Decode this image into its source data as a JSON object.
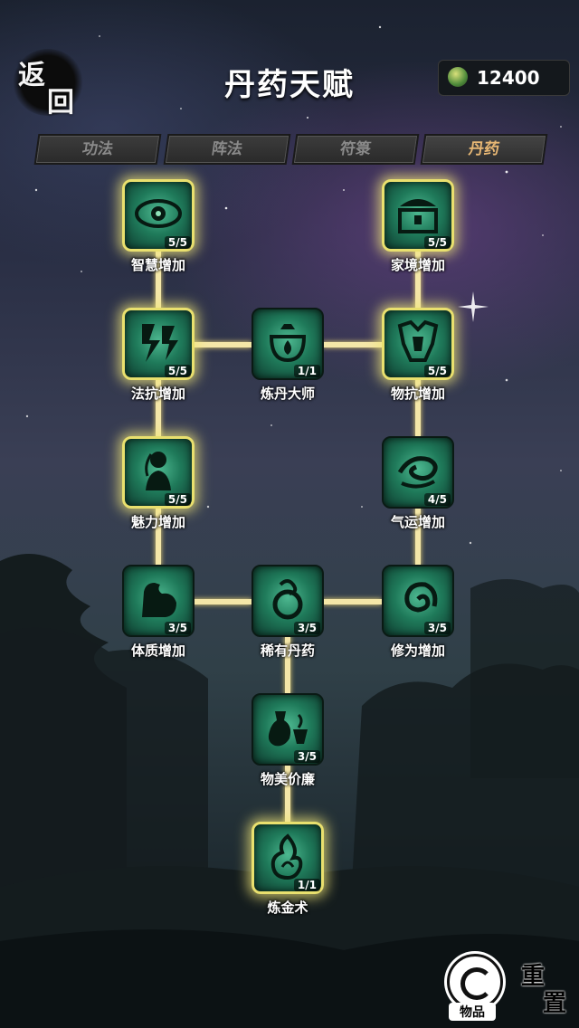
{
  "header": {
    "back_char1": "返",
    "back_char2": "回",
    "title": "丹药天赋",
    "currency_value": "12400"
  },
  "tabs": [
    {
      "label": "功法",
      "active": false
    },
    {
      "label": "阵法",
      "active": false
    },
    {
      "label": "符箓",
      "active": false
    },
    {
      "label": "丹药",
      "active": true
    }
  ],
  "nodes": {
    "wisdom": {
      "label": "智慧增加",
      "level": "5/5",
      "icon": "eye-icon"
    },
    "home": {
      "label": "家境增加",
      "level": "5/5",
      "icon": "treasure-chest-icon"
    },
    "magres": {
      "label": "法抗增加",
      "level": "5/5",
      "icon": "lightning-shield-icon"
    },
    "master": {
      "label": "炼丹大师",
      "level": "1/1",
      "icon": "cauldron-icon"
    },
    "physres": {
      "label": "物抗增加",
      "level": "5/5",
      "icon": "armor-icon"
    },
    "charm": {
      "label": "魅力增加",
      "level": "5/5",
      "icon": "maiden-icon"
    },
    "luck": {
      "label": "气运增加",
      "level": "4/5",
      "icon": "swirl-icon"
    },
    "physique": {
      "label": "体质增加",
      "level": "3/5",
      "icon": "muscle-icon"
    },
    "rare": {
      "label": "稀有丹药",
      "level": "3/5",
      "icon": "elixir-icon"
    },
    "cultivate": {
      "label": "修为增加",
      "level": "3/5",
      "icon": "spiral-icon"
    },
    "cheap": {
      "label": "物美价廉",
      "level": "3/5",
      "icon": "potion-bottle-icon"
    },
    "alchemy": {
      "label": "炼金术",
      "level": "1/1",
      "icon": "flame-icon"
    }
  },
  "bottom": {
    "items_label": "物品",
    "reset_char1": "重",
    "reset_char2": "置"
  }
}
